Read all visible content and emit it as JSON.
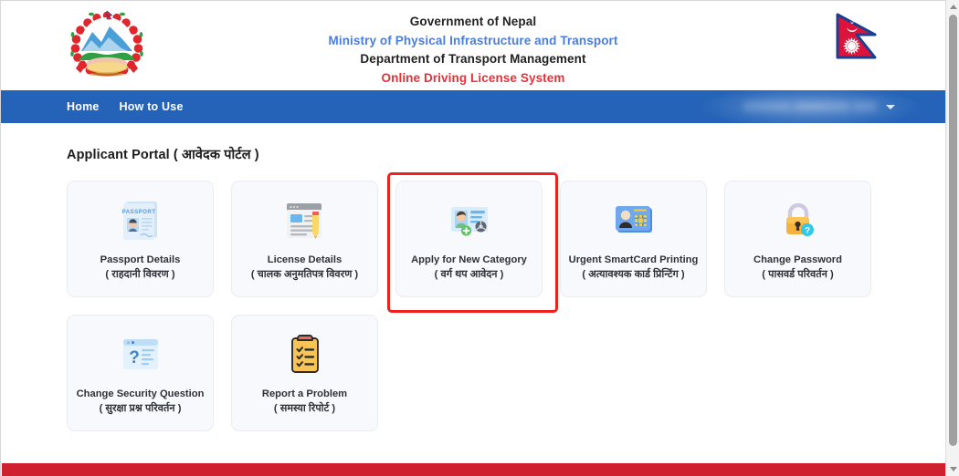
{
  "header": {
    "emblem_icon": "nepal-government-emblem",
    "flag_icon": "nepal-flag",
    "line1": "Government of Nepal",
    "line2": "Ministry of Physical Infrastructure and Transport",
    "line3": "Department of Transport Management",
    "line4": "Online Driving License System",
    "colors": {
      "line2": "#4a7ede",
      "line4": "#e8303a"
    }
  },
  "navbar": {
    "background": "#2463b8",
    "links": [
      {
        "label": "Home"
      },
      {
        "label": "How to Use"
      }
    ],
    "user_menu": {
      "label": "",
      "redacted": true,
      "caret_icon": "chevron-down-icon"
    }
  },
  "main": {
    "portal_title": "Applicant Portal ( आवेदक पोर्टल )",
    "cards": [
      {
        "icon": "passport-document-icon",
        "title_en": "Passport Details",
        "title_np": "( राहदानी विवरण )",
        "highlighted": false
      },
      {
        "icon": "license-document-pencil-icon",
        "title_en": "License Details",
        "title_np": "( चालक अनुमतिपत्र विवरण )",
        "highlighted": false
      },
      {
        "icon": "new-category-license-card-plus-icon",
        "title_en": "Apply for New Category",
        "title_np": "( वर्ग थप आवेदन )",
        "highlighted": true
      },
      {
        "icon": "smartcard-chip-icon",
        "title_en": "Urgent SmartCard Printing",
        "title_np": "( अत्यावश्यक कार्ड प्रिन्टिंग )",
        "highlighted": false
      },
      {
        "icon": "padlock-question-icon",
        "title_en": "Change Password",
        "title_np": "( पासवर्ड परिवर्तन )",
        "highlighted": false
      },
      {
        "icon": "question-browser-window-icon",
        "title_en": "Change Security Question",
        "title_np": "( सुरक्षा प्रश्न परिवर्तन )",
        "highlighted": false
      },
      {
        "icon": "clipboard-checklist-icon",
        "title_en": "Report a Problem",
        "title_np": "( समस्या रिपोर्ट )",
        "highlighted": false
      }
    ],
    "highlight_color": "#ef2020"
  },
  "footer": {
    "bar_color": "#cf2030"
  },
  "scrollbar": {
    "up_icon": "scroll-up-arrow-icon",
    "down_icon": "scroll-down-arrow-icon"
  }
}
